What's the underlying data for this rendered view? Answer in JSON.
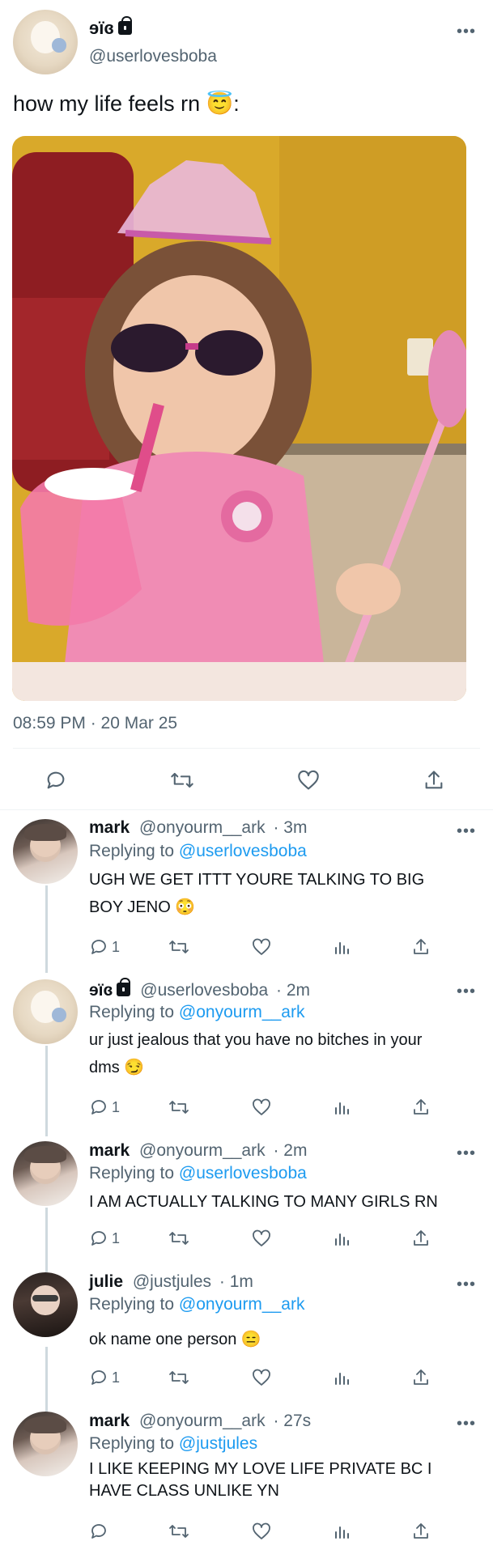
{
  "main_tweet": {
    "display_name": "ɘïɞ",
    "handle": "@userlovesboba",
    "text": "how my life feels rn 😇:",
    "timestamp": "08:59 PM · 20 Mar 25",
    "avatar_icon": "bunny-avatar"
  },
  "replies": [
    {
      "display_name": "mark",
      "handle": "@onyourm__ark",
      "time": "· 3m",
      "replying_prefix": "Replying to ",
      "replying_to": "@userlovesboba",
      "lines": [
        "UGH WE GET ITTT YOURE TALKING TO BIG",
        "BOY JENO 😳"
      ],
      "reply_count": "1"
    },
    {
      "display_name": "ɘïɞ",
      "handle": "@userlovesboba",
      "time": "· 2m",
      "replying_prefix": "Replying to ",
      "replying_to": "@onyourm__ark",
      "lines": [
        "ur just jealous that you have no bitches in your",
        "dms 😏"
      ],
      "reply_count": "1"
    },
    {
      "display_name": "mark",
      "handle": "@onyourm__ark",
      "time": "· 2m",
      "replying_prefix": "Replying to ",
      "replying_to": "@userlovesboba",
      "lines": [
        "I AM ACTUALLY TALKING TO MANY GIRLS RN"
      ],
      "reply_count": "1"
    },
    {
      "display_name": "julie",
      "handle": "@justjules",
      "time": "· 1m",
      "replying_prefix": "Replying to ",
      "replying_to": "@onyourm__ark",
      "lines": [
        "ok name one person 😑"
      ],
      "reply_count": "1"
    },
    {
      "display_name": "mark",
      "handle": "@onyourm__ark",
      "time": "· 27s",
      "replying_prefix": "Replying to ",
      "replying_to": "@justjules",
      "lines": [
        "I LIKE KEEPING MY LOVE LIFE PRIVATE BC I",
        "HAVE CLASS UNLIKE YN"
      ],
      "reply_count": ""
    }
  ],
  "more_label": "•••",
  "colors": {
    "link": "#1d9bf0",
    "secondary": "#536471",
    "divider": "#eff3f4"
  }
}
